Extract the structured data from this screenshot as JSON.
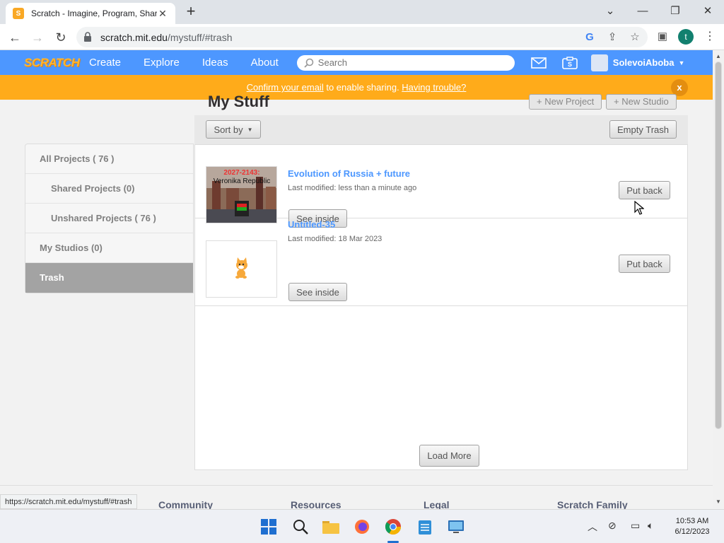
{
  "browser": {
    "tab_title": "Scratch - Imagine, Program, Shar",
    "favicon_letter": "S",
    "url_host": "scratch.mit.edu",
    "url_path": "/mystuff/#trash",
    "profile_initial": "t"
  },
  "scratch_nav": {
    "logo": "SCRATCH",
    "links": [
      "Create",
      "Explore",
      "Ideas",
      "About"
    ],
    "search_placeholder": "Search",
    "username": "SolevoiAboba"
  },
  "banner": {
    "link1": "Confirm your email",
    "middle": " to enable sharing. ",
    "link2": "Having trouble?",
    "close": "x"
  },
  "header": {
    "title": "My Stuff",
    "new_project": "+ New Project",
    "new_studio": "+ New Studio",
    "sort_by": "Sort by",
    "empty_trash": "Empty Trash"
  },
  "sidebar": {
    "items": [
      {
        "label": "All Projects ( 76 )"
      },
      {
        "label": "Shared Projects (0)"
      },
      {
        "label": "Unshared Projects ( 76 )"
      },
      {
        "label": "My Studios (0)"
      },
      {
        "label": "Trash"
      }
    ]
  },
  "projects": [
    {
      "title": "Evolution of Russia + future",
      "modified": "Last modified: less than a minute ago",
      "thumb_text1": "2027-2143:",
      "thumb_text2": "Veronika Republic",
      "see_inside": "See inside",
      "put_back": "Put back"
    },
    {
      "title": "Untitled-35",
      "modified": "Last modified: 18 Mar 2023",
      "see_inside": "See inside",
      "put_back": "Put back"
    }
  ],
  "load_more": "Load More",
  "footer": {
    "columns": [
      "Community",
      "Resources",
      "Legal",
      "Scratch Family"
    ]
  },
  "status_url": "https://scratch.mit.edu/mystuff/#trash",
  "taskbar": {
    "time": "10:53 AM",
    "date": "6/12/2023"
  }
}
